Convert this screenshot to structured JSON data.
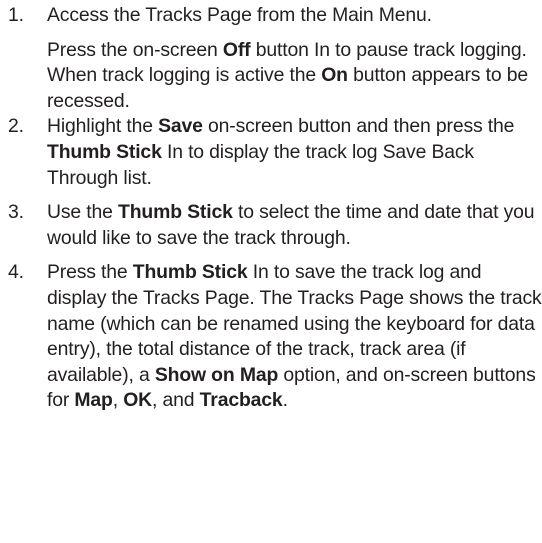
{
  "steps": [
    {
      "number": "1.",
      "parts": [
        {
          "t": "Access the Tracks Page from the Main Menu."
        }
      ],
      "note": [
        {
          "t": "Press the on-screen "
        },
        {
          "t": "Off",
          "b": true
        },
        {
          "t": " button In to pause track logging. When track logging is active the "
        },
        {
          "t": "On",
          "b": true
        },
        {
          "t": " button appears to be recessed."
        }
      ]
    },
    {
      "number": "2.",
      "parts": [
        {
          "t": "Highlight the "
        },
        {
          "t": "Save",
          "b": true
        },
        {
          "t": " on-screen button and then press the "
        },
        {
          "t": "Thumb Stick",
          "b": true
        },
        {
          "t": " In to display the track log Save Back Through list."
        }
      ]
    },
    {
      "number": "3.",
      "parts": [
        {
          "t": "Use the "
        },
        {
          "t": "Thumb Stick",
          "b": true
        },
        {
          "t": " to select the time and date that you would like to save the track through."
        }
      ]
    },
    {
      "number": "4.",
      "parts": [
        {
          "t": "Press the "
        },
        {
          "t": "Thumb Stick",
          "b": true
        },
        {
          "t": " In to save the track log and display the Tracks Page. The Tracks Page shows the track name (which can be renamed using the keyboard for data entry), the total distance of the track, track area (if available), a "
        },
        {
          "t": "Show on Map",
          "b": true
        },
        {
          "t": " option, and on-screen buttons for "
        },
        {
          "t": "Map",
          "b": true
        },
        {
          "t": ", "
        },
        {
          "t": "OK",
          "b": true
        },
        {
          "t": ", and "
        },
        {
          "t": "Tracback",
          "b": true
        },
        {
          "t": "."
        }
      ]
    }
  ]
}
